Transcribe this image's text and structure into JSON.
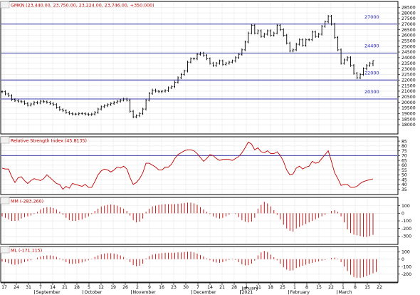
{
  "chart_data": {
    "type": "line",
    "x_dates": [
      "17",
      "24",
      "31",
      "7",
      "14",
      "21",
      "28",
      "5",
      "12",
      "19",
      "26",
      "2",
      "9",
      "16",
      "23",
      "30",
      "7",
      "14",
      "21",
      "28",
      "4",
      "11",
      "18",
      "25",
      "1",
      "8",
      "15",
      "22",
      "1",
      "8",
      "15",
      "22"
    ],
    "x_months": [
      {
        "label": "September",
        "after_tick": 3
      },
      {
        "label": "October",
        "after_tick": 7
      },
      {
        "label": "November",
        "after_tick": 11
      },
      {
        "label": "December",
        "after_tick": 16
      },
      {
        "label": "2021",
        "after_tick": 20
      },
      {
        "label": "January",
        "after_tick": 20
      },
      {
        "label": "February",
        "after_tick": 24
      },
      {
        "label": "March",
        "after_tick": 28
      }
    ],
    "panels": [
      {
        "id": "price",
        "type": "ohlc",
        "title": "GMKN (23,440.00, 23,750.00, 23,224.00, 23,746.00, +350.000)",
        "ylim": [
          17300,
          28900
        ],
        "yticks": [
          18000,
          18500,
          19000,
          19500,
          20000,
          20500,
          21000,
          21500,
          22000,
          22500,
          23000,
          23500,
          24000,
          24500,
          25000,
          25500,
          26000,
          26500,
          27000,
          27500,
          28000,
          28500
        ],
        "hlines": [
          {
            "value": 27000,
            "label": "27000"
          },
          {
            "value": 24400,
            "label": "24400"
          },
          {
            "value": 22000,
            "label": "22000"
          },
          {
            "value": 20300,
            "label": "20300"
          }
        ],
        "closes": [
          20950,
          20750,
          20600,
          20250,
          20150,
          20100,
          20050,
          19900,
          19750,
          19850,
          20000,
          19950,
          20100,
          20050,
          20000,
          19900,
          19800,
          19550,
          19350,
          19250,
          19100,
          19000,
          18950,
          18950,
          19000,
          19000,
          18950,
          18900,
          18950,
          19100,
          19400,
          19600,
          19700,
          19800,
          19900,
          20000,
          20100,
          20200,
          20300,
          20200,
          19200,
          18700,
          18800,
          19000,
          19400,
          20200,
          20800,
          21100,
          21000,
          20950,
          21000,
          21050,
          21300,
          21400,
          21800,
          22200,
          22500,
          22800,
          23600,
          23900,
          23900,
          24300,
          24400,
          24200,
          23900,
          23500,
          23300,
          23500,
          23700,
          23400,
          23500,
          23600,
          23700,
          24000,
          24300,
          24700,
          25400,
          26200,
          26900,
          26200,
          26400,
          25900,
          26100,
          26400,
          26000,
          26200,
          26900,
          26500,
          26000,
          25300,
          24600,
          24700,
          25200,
          25600,
          25100,
          25600,
          25600,
          26300,
          25900,
          26100,
          26800,
          27200,
          27700,
          27000,
          25800,
          24700,
          23500,
          23800,
          24000,
          23300,
          22600,
          22200,
          22500,
          23000,
          23300,
          23500,
          23746
        ],
        "last_ohlc": {
          "open": 23440,
          "high": 23750,
          "low": 23224,
          "close": 23746
        }
      },
      {
        "id": "rsi",
        "type": "line",
        "title": "Relative Strength Index (45.8135)",
        "ylim": [
          31,
          88
        ],
        "yticks": [
          35,
          40,
          45,
          50,
          55,
          60,
          65,
          70,
          75,
          80,
          85
        ],
        "hlines": [
          {
            "value": 70,
            "label": ""
          }
        ],
        "values": [
          57,
          56,
          56,
          48,
          42,
          47,
          48,
          44,
          41,
          44,
          46,
          45,
          44,
          46,
          50,
          47,
          44,
          41,
          40,
          35,
          38,
          36,
          41,
          40,
          39,
          38,
          40,
          37,
          37,
          43,
          50,
          54,
          56,
          55,
          53,
          55,
          58,
          57,
          59,
          56,
          47,
          40,
          42,
          46,
          52,
          62,
          62,
          60,
          58,
          55,
          55,
          58,
          58,
          61,
          67,
          71,
          73,
          75,
          76,
          76,
          75,
          72,
          68,
          64,
          67,
          71,
          70,
          67,
          65,
          66,
          66,
          66,
          65,
          67,
          69,
          73,
          78,
          84,
          82,
          76,
          78,
          74,
          73,
          75,
          72,
          72,
          74,
          70,
          64,
          55,
          50,
          51,
          57,
          59,
          56,
          58,
          59,
          64,
          62,
          63,
          67,
          71,
          75,
          64,
          52,
          46,
          39,
          40,
          40,
          37,
          37,
          38,
          41,
          43,
          44,
          45,
          45.8135
        ]
      },
      {
        "id": "mm",
        "type": "bar",
        "title": "MM (-283.260)",
        "ylim": [
          -390,
          190
        ],
        "yticks": [
          100,
          0,
          -100,
          -200,
          -300
        ],
        "values": [
          -40,
          -60,
          -80,
          -100,
          -100,
          -95,
          -70,
          -50,
          -40,
          -30,
          -10,
          20,
          50,
          70,
          80,
          80,
          70,
          50,
          20,
          -20,
          -60,
          -90,
          -100,
          -100,
          -90,
          -80,
          -60,
          -40,
          -10,
          30,
          60,
          90,
          100,
          110,
          115,
          110,
          100,
          80,
          60,
          30,
          -30,
          -90,
          -120,
          -110,
          -70,
          20,
          60,
          90,
          100,
          110,
          115,
          120,
          120,
          120,
          120,
          125,
          130,
          135,
          140,
          140,
          130,
          110,
          80,
          50,
          20,
          -10,
          -40,
          -60,
          -70,
          -60,
          -40,
          -20,
          0,
          -10,
          -50,
          -90,
          -110,
          -120,
          -110,
          -60,
          60,
          110,
          150,
          130,
          90,
          40,
          -20,
          -80,
          -150,
          -200,
          -230,
          -240,
          -200,
          -180,
          -160,
          -140,
          -120,
          -100,
          -80,
          -60,
          -40,
          -20,
          0,
          30,
          40,
          20,
          -40,
          -120,
          -210,
          -260,
          -280,
          -290,
          -300,
          -310,
          -310,
          -300,
          -283.26
        ]
      },
      {
        "id": "ml",
        "type": "bar",
        "title": "ML (-171.115)",
        "ylim": [
          -290,
          150
        ],
        "yticks": [
          100,
          0,
          -100,
          -200
        ],
        "values": [
          -30,
          -40,
          -55,
          -70,
          -75,
          -70,
          -55,
          -40,
          -25,
          -15,
          0,
          20,
          35,
          45,
          50,
          50,
          45,
          30,
          10,
          -15,
          -40,
          -60,
          -65,
          -60,
          -55,
          -45,
          -30,
          -15,
          5,
          30,
          50,
          65,
          75,
          80,
          80,
          75,
          65,
          50,
          30,
          5,
          -40,
          -80,
          -95,
          -90,
          -60,
          10,
          40,
          60,
          70,
          75,
          80,
          85,
          85,
          85,
          85,
          90,
          90,
          95,
          100,
          100,
          90,
          75,
          55,
          35,
          10,
          -15,
          -35,
          -45,
          -50,
          -40,
          -25,
          -10,
          5,
          -10,
          -40,
          -70,
          -85,
          -80,
          -60,
          -20,
          50,
          90,
          110,
          95,
          60,
          25,
          -15,
          -60,
          -110,
          -140,
          -155,
          -150,
          -120,
          -105,
          -90,
          -75,
          -60,
          -50,
          -40,
          -30,
          -20,
          -10,
          0,
          15,
          20,
          5,
          -40,
          -100,
          -160,
          -210,
          -240,
          -250,
          -250,
          -240,
          -225,
          -210,
          -190,
          -171.115
        ]
      }
    ]
  },
  "colors": {
    "price_bars": "#000000",
    "hline": "#2020a0",
    "hline_label": "#2020c0",
    "rsi_line": "#c00000",
    "mm_bars": "#c00000",
    "ml_bars": "#c00000",
    "title_text": "#c00000",
    "grid": "#e6e6e6",
    "axis": "#000000"
  }
}
